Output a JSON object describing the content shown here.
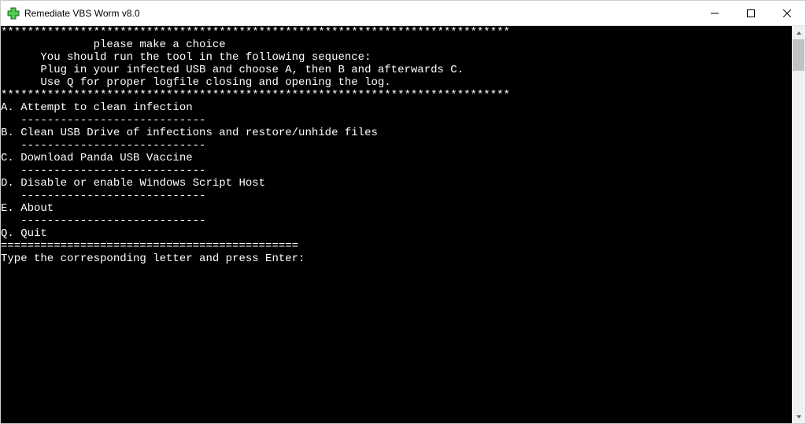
{
  "window": {
    "title": "Remediate VBS Worm v8.0",
    "icon_name": "green-plus-icon"
  },
  "console": {
    "lines": [
      "*****************************************************************************",
      "              please make a choice",
      "      You should run the tool in the following sequence:",
      "      Plug in your infected USB and choose A, then B and afterwards C.",
      "      Use Q for proper logfile closing and opening the log.",
      "*****************************************************************************",
      "A. Attempt to clean infection",
      "   ----------------------------",
      "B. Clean USB Drive of infections and restore/unhide files",
      "   ----------------------------",
      "C. Download Panda USB Vaccine",
      "   ----------------------------",
      "D. Disable or enable Windows Script Host",
      "   ----------------------------",
      "E. About",
      "   ----------------------------",
      "Q. Quit",
      "=============================================",
      "Type the corresponding letter and press Enter:"
    ]
  },
  "menu_options": [
    {
      "key": "A",
      "label": "Attempt to clean infection"
    },
    {
      "key": "B",
      "label": "Clean USB Drive of infections and restore/unhide files"
    },
    {
      "key": "C",
      "label": "Download Panda USB Vaccine"
    },
    {
      "key": "D",
      "label": "Disable or enable Windows Script Host"
    },
    {
      "key": "E",
      "label": "About"
    },
    {
      "key": "Q",
      "label": "Quit"
    }
  ],
  "prompt": "Type the corresponding letter and press Enter:"
}
